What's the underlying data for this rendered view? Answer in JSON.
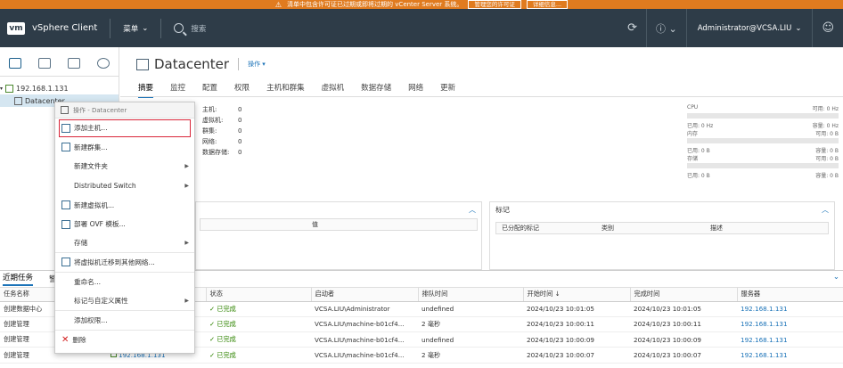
{
  "banner": {
    "text": "清单中包含许可证已过期或即将过期的 vCenter Server 系统。",
    "btn_manage": "管理您的许可证",
    "btn_details": "详细信息..."
  },
  "header": {
    "logo": "vm",
    "product": "vSphere Client",
    "menu": "菜单",
    "search_placeholder": "搜索",
    "user": "Administrator@VCSA.LIU"
  },
  "tree": {
    "vcenter": "192.168.1.131",
    "datacenter": "Datacenter"
  },
  "main": {
    "title": "Datacenter",
    "actions": "操作 ▾",
    "tabs": [
      "摘要",
      "监控",
      "配置",
      "权限",
      "主机和群集",
      "虚拟机",
      "数据存储",
      "网络",
      "更新"
    ],
    "stats": [
      {
        "label": "主机:",
        "value": "0"
      },
      {
        "label": "虚拟机:",
        "value": "0"
      },
      {
        "label": "群集:",
        "value": "0"
      },
      {
        "label": "网络:",
        "value": "0"
      },
      {
        "label": "数据存储:",
        "value": "0"
      }
    ],
    "resources": [
      {
        "name": "CPU",
        "free": "可用: 0 Hz",
        "used": "已用: 0 Hz",
        "cap": "容量: 0 Hz"
      },
      {
        "name": "内存",
        "free": "可用: 0 B",
        "used": "已用: 0 B",
        "cap": "容量: 0 B"
      },
      {
        "name": "存储",
        "free": "可用: 0 B",
        "used": "已用: 0 B",
        "cap": "容量: 0 B"
      }
    ],
    "attr_col": "值",
    "tags_title": "标记",
    "tags_cols": [
      "已分配的标记",
      "类别",
      "描述"
    ]
  },
  "context_menu": {
    "header": "操作 - Datacenter",
    "items": [
      {
        "label": "添加主机...",
        "highlight": true
      },
      {
        "label": "新建群集..."
      },
      {
        "label": "新建文件夹",
        "submenu": true
      },
      {
        "label": "Distributed Switch",
        "submenu": true
      },
      {
        "label": "新建虚拟机..."
      },
      {
        "label": "部署 OVF 模板..."
      },
      {
        "label": "存储",
        "submenu": true
      },
      {
        "label": "将虚拟机迁移到其他网络..."
      },
      {
        "label": "重命名..."
      },
      {
        "label": "标记与自定义属性",
        "submenu": true
      },
      {
        "label": "添加权限..."
      },
      {
        "label": "删除"
      }
    ]
  },
  "tasks": {
    "tabs": [
      "近期任务",
      "警报"
    ],
    "columns": [
      "任务名称",
      "对象",
      "状态",
      "启动者",
      "排队时间",
      "开始时间 ↓",
      "完成时间",
      "服务器"
    ],
    "rows": [
      {
        "name": "创建数据中心",
        "object": "",
        "status": "✓ 已完成",
        "initiator": "VCSA.LIU\\Administrator",
        "queued": "undefined",
        "start": "2024/10/23 10:01:05",
        "end": "2024/10/23 10:01:05",
        "server": "192.168.1.131"
      },
      {
        "name": "创建管理",
        "object": "",
        "status": "✓ 已完成",
        "initiator": "VCSA.LIU\\machine-b01cf4...",
        "queued": "2 毫秒",
        "start": "2024/10/23 10:00:11",
        "end": "2024/10/23 10:00:11",
        "server": "192.168.1.131"
      },
      {
        "name": "创建管理",
        "object": "",
        "status": "✓ 已完成",
        "initiator": "VCSA.LIU\\machine-b01cf4...",
        "queued": "undefined",
        "start": "2024/10/23 10:00:09",
        "end": "2024/10/23 10:00:09",
        "server": "192.168.1.131"
      },
      {
        "name": "创建管理",
        "object": "192.168.1.131",
        "status": "✓ 已完成",
        "initiator": "VCSA.LIU\\machine-b01cf4...",
        "queued": "2 毫秒",
        "start": "2024/10/23 10:00:07",
        "end": "2024/10/23 10:00:07",
        "server": "192.168.1.131"
      }
    ]
  }
}
